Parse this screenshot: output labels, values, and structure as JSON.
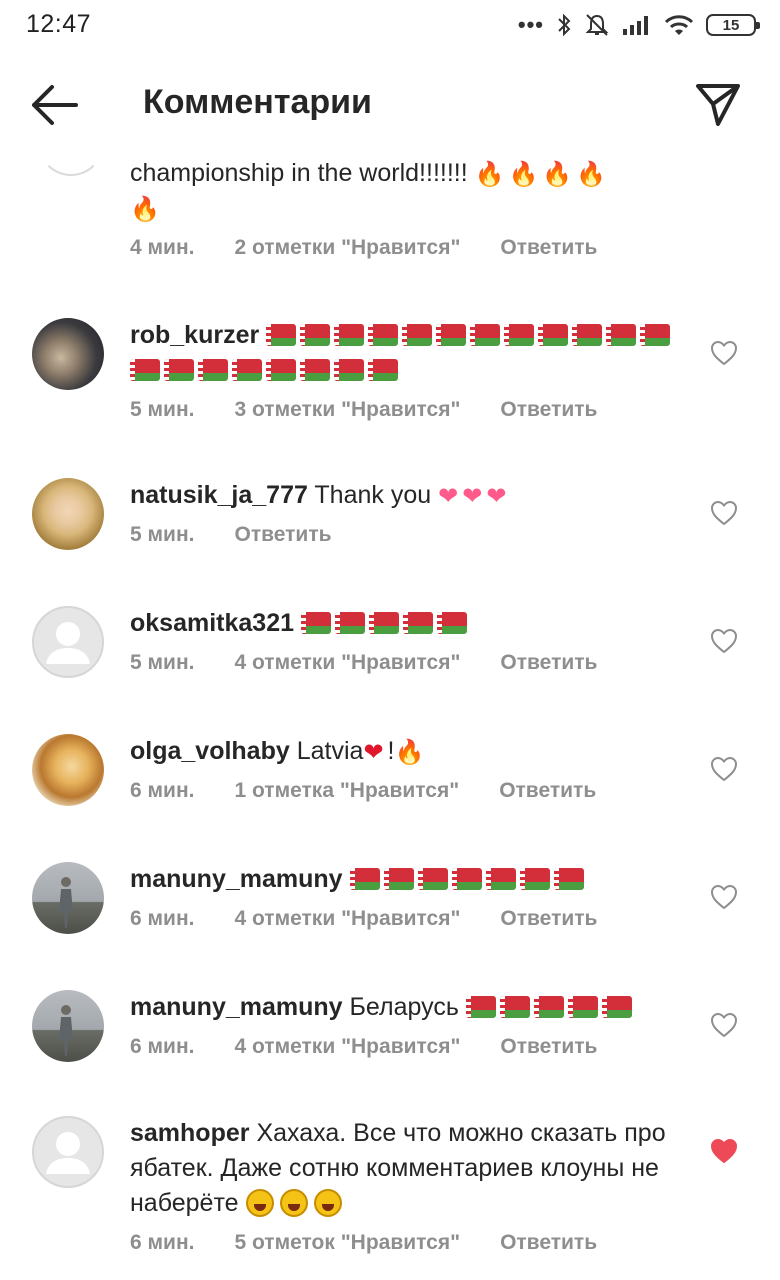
{
  "status_bar": {
    "time": "12:47",
    "dots": "•••",
    "battery": "15"
  },
  "header": {
    "title": "Комментарии"
  },
  "comments": [
    {
      "username": "",
      "text": "championship in the world!!!!!!! ",
      "time": "4 мин.",
      "likes": "2 отметки \"Нравится\"",
      "reply": "Ответить",
      "liked": false
    },
    {
      "username": "rob_kurzer",
      "text": "",
      "time": "5 мин.",
      "likes": "3 отметки \"Нравится\"",
      "reply": "Ответить",
      "liked": false
    },
    {
      "username": "natusik_ja_777",
      "text": "Thank you",
      "time": "5 мин.",
      "likes": "",
      "reply": "Ответить",
      "liked": false
    },
    {
      "username": "oksamitka321",
      "text": "",
      "time": "5 мин.",
      "likes": "4 отметки \"Нравится\"",
      "reply": "Ответить",
      "liked": false
    },
    {
      "username": "olga_volhaby",
      "text": "Latvia",
      "text_after": "!",
      "time": "6 мин.",
      "likes": "1 отметка \"Нравится\"",
      "reply": "Ответить",
      "liked": false
    },
    {
      "username": "manuny_mamuny",
      "text": "",
      "time": "6 мин.",
      "likes": "4 отметки \"Нравится\"",
      "reply": "Ответить",
      "liked": false
    },
    {
      "username": "manuny_mamuny",
      "text": "Беларусь",
      "time": "6 мин.",
      "likes": "4 отметки \"Нравится\"",
      "reply": "Ответить",
      "liked": false
    },
    {
      "username": "samhoper",
      "text": "Хахаха. Все что можно сказать про ябатек. Даже сотню комментариев клоуны не наберёте",
      "time": "6 мин.",
      "likes": "5 отметок \"Нравится\"",
      "reply": "Ответить",
      "liked": true
    }
  ],
  "colors": {
    "text": "#262626",
    "meta": "#8e8e8e",
    "liked_heart": "#ed4956",
    "flag_red": "#d22f3a",
    "flag_green": "#4a9e3f"
  },
  "icons": {
    "back": "arrow-left-icon",
    "send": "paper-plane-icon",
    "like": "heart-outline-icon",
    "liked": "heart-filled-icon"
  }
}
